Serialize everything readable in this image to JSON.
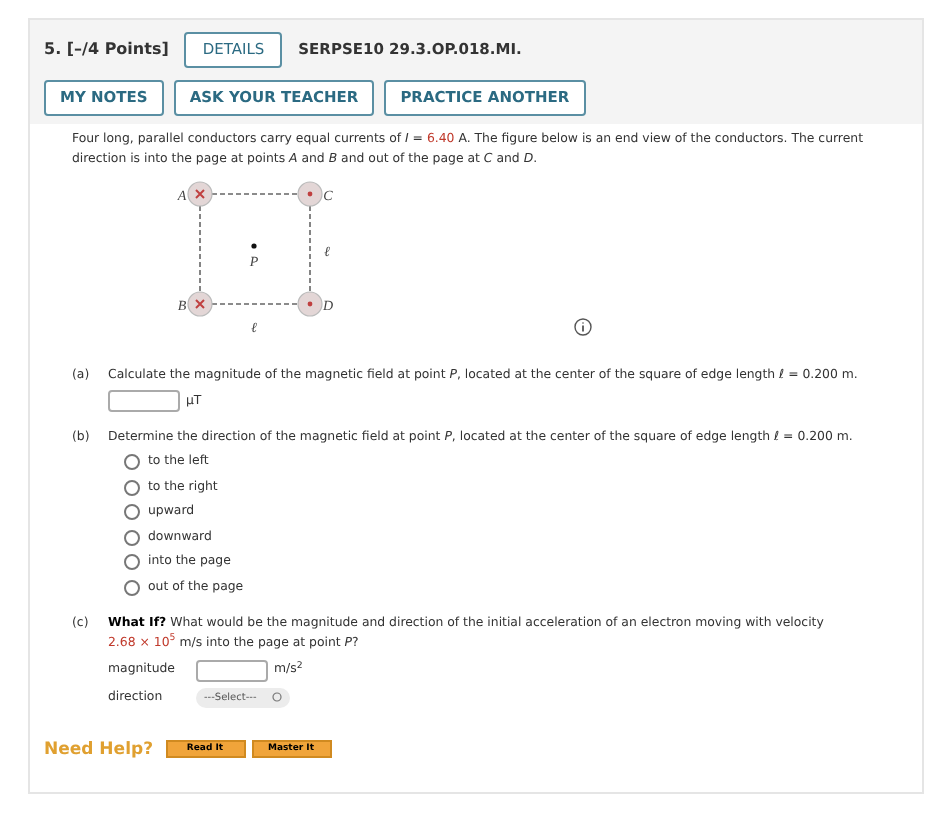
{
  "question": {
    "number": "5.",
    "points": "[–/4 Points]",
    "details_button": "DETAILS",
    "code": "SERPSE10 29.3.OP.018.MI."
  },
  "buttons": [
    "MY NOTES",
    "ASK YOUR TEACHER",
    "PRACTICE ANOTHER"
  ],
  "intro": {
    "before": "Four long, parallel conductors carry equal currents of *I* = ",
    "value": "6.40",
    "after": " A. The figure below is an end view of the conductors. The current direction is into the page at points *A* and *B* and out of the page at *C* and *D*."
  },
  "figure": {
    "conductors": [
      {
        "label": "A",
        "kind": "into"
      },
      {
        "label": "C",
        "kind": "out"
      },
      {
        "label": "B",
        "kind": "into"
      },
      {
        "label": "D",
        "kind": "out"
      }
    ],
    "point_label": "P",
    "side_label": "ℓ",
    "bottom_label": "ℓ"
  },
  "parts": [
    {
      "letter": "(a)",
      "kind": "numeric",
      "prompt": "Calculate the magnitude of the magnetic field at point *P*, located at the center of the square of edge length ℓ = 0.200 m.",
      "unit": "μT"
    },
    {
      "letter": "(b)",
      "kind": "choice",
      "prompt": "Determine the direction of the magnetic field at point *P*, located at the center of the square of edge length ℓ = 0.200 m.",
      "options": [
        {
          "label": "to the left",
          "selected": false
        },
        {
          "label": "to the right",
          "selected": false
        },
        {
          "label": "upward",
          "selected": false
        },
        {
          "label": "downward",
          "selected": false
        },
        {
          "label": "into the page",
          "selected": false
        },
        {
          "label": "out of the page",
          "selected": false
        }
      ]
    },
    {
      "letter": "(c)",
      "kind": "whatif",
      "lead": "What If?",
      "prompt_before": " What would be the magnitude and direction of the initial acceleration of an electron moving with velocity",
      "value": "2.68 × 10$^{5}$",
      "prompt_after": " m/s into the page at point *P*?",
      "magnitude_label": "magnitude",
      "magnitude_unit": "m/s$^{2}$",
      "direction_label": "direction",
      "direction_select": "---Select---"
    }
  ],
  "help": {
    "label": "Need Help?",
    "buttons": [
      "Read It",
      "Master It"
    ]
  }
}
